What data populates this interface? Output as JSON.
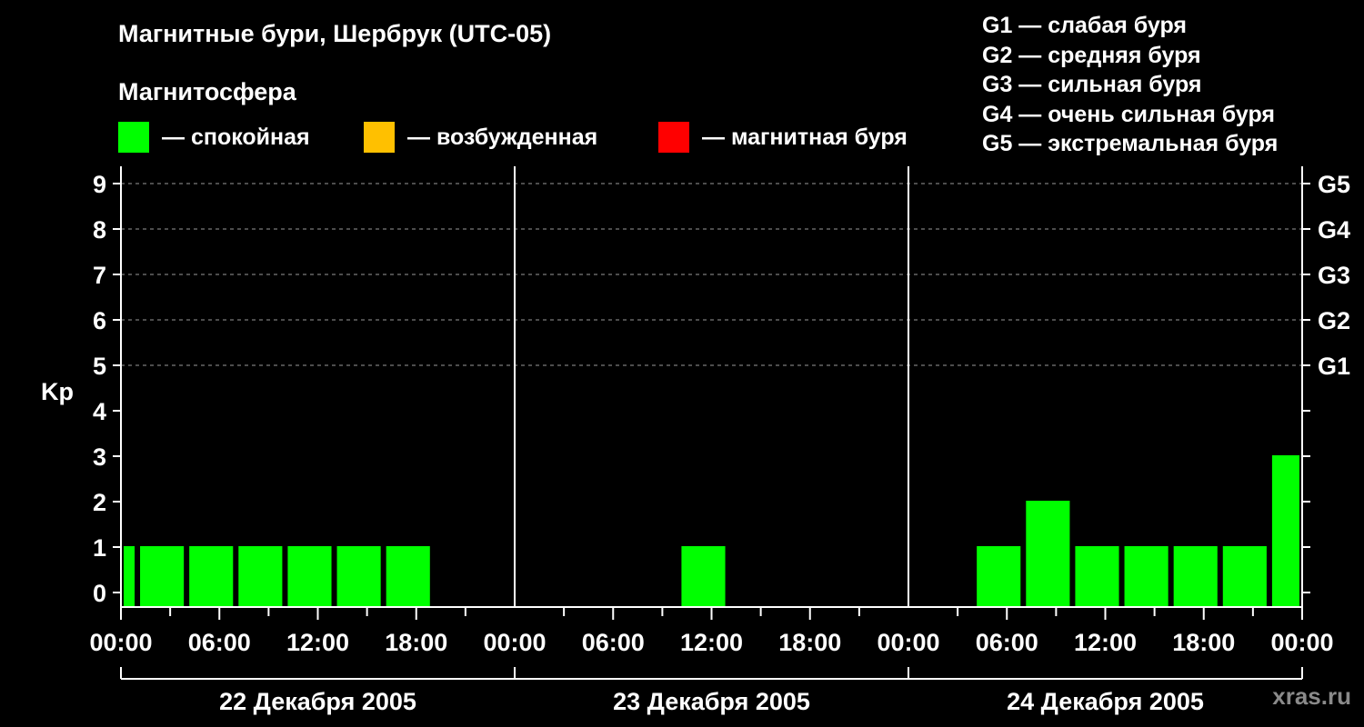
{
  "header": {
    "title": "Магнитные бури, Шербрук (UTC-05)",
    "subtitle": "Магнитосфера"
  },
  "legend": [
    {
      "label": "— спокойная",
      "color": "#00ff00"
    },
    {
      "label": "— возбужденная",
      "color": "#ffc000"
    },
    {
      "label": "— магнитная буря",
      "color": "#ff0000"
    }
  ],
  "g_legend": [
    "G1 — слабая буря",
    "G2 — средняя буря",
    "G3 — сильная буря",
    "G4 — очень сильная буря",
    "G5 — экстремальная буря"
  ],
  "watermark": "xras.ru",
  "chart_data": {
    "type": "bar",
    "title": "Магнитные бури, Шербрук (UTC-05)",
    "ylabel": "Kp",
    "ylim": [
      0,
      9
    ],
    "yticks": [
      0,
      1,
      2,
      3,
      4,
      5,
      6,
      7,
      8,
      9
    ],
    "grid": "dashed at Kp 5-9",
    "right_axis": [
      {
        "label": "G1",
        "kp": 5
      },
      {
        "label": "G2",
        "kp": 6
      },
      {
        "label": "G3",
        "kp": 7
      },
      {
        "label": "G4",
        "kp": 8
      },
      {
        "label": "G5",
        "kp": 9
      }
    ],
    "xtick_labels": [
      "00:00",
      "06:00",
      "12:00",
      "18:00",
      "00:00",
      "06:00",
      "12:00",
      "18:00",
      "00:00",
      "06:00",
      "12:00",
      "18:00",
      "00:00"
    ],
    "days": [
      "22 Декабря 2005",
      "23 Декабря 2005",
      "24 Декабря 2005"
    ],
    "bar_color": "#00ff00",
    "bars": [
      {
        "day": 0,
        "start_hour": 0,
        "end_hour": 1,
        "kp": 1
      },
      {
        "day": 0,
        "start_hour": 1,
        "end_hour": 4,
        "kp": 1
      },
      {
        "day": 0,
        "start_hour": 4,
        "end_hour": 7,
        "kp": 1
      },
      {
        "day": 0,
        "start_hour": 7,
        "end_hour": 10,
        "kp": 1
      },
      {
        "day": 0,
        "start_hour": 10,
        "end_hour": 13,
        "kp": 1
      },
      {
        "day": 0,
        "start_hour": 13,
        "end_hour": 16,
        "kp": 1
      },
      {
        "day": 0,
        "start_hour": 16,
        "end_hour": 19,
        "kp": 1
      },
      {
        "day": 1,
        "start_hour": 10,
        "end_hour": 13,
        "kp": 1
      },
      {
        "day": 2,
        "start_hour": 4,
        "end_hour": 7,
        "kp": 1
      },
      {
        "day": 2,
        "start_hour": 7,
        "end_hour": 10,
        "kp": 2
      },
      {
        "day": 2,
        "start_hour": 10,
        "end_hour": 13,
        "kp": 1
      },
      {
        "day": 2,
        "start_hour": 13,
        "end_hour": 16,
        "kp": 1
      },
      {
        "day": 2,
        "start_hour": 16,
        "end_hour": 19,
        "kp": 1
      },
      {
        "day": 2,
        "start_hour": 19,
        "end_hour": 22,
        "kp": 1
      },
      {
        "day": 2,
        "start_hour": 22,
        "end_hour": 24,
        "kp": 3
      }
    ]
  }
}
